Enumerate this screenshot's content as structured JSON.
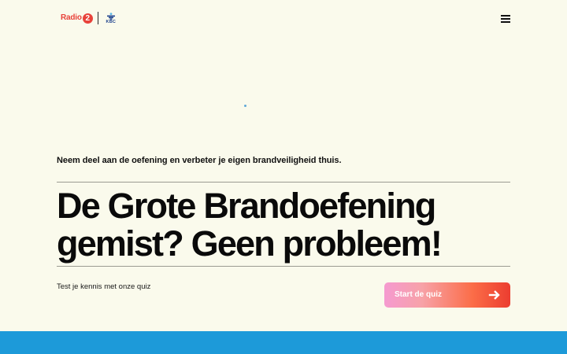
{
  "header": {
    "logo": {
      "radio_text": "Radio",
      "radio_number": "2",
      "partner_text": "KBC"
    },
    "menu_icon": "hamburger-menu-icon"
  },
  "hero": {
    "subtitle": "Neem deel aan de oefening en verbeter je eigen brandveiligheid thuis.",
    "headline_line1": "De Grote Brandoefening",
    "headline_line2": "gemist? Geen probleem!",
    "quiz_prompt": "Test je kennis met onze quiz",
    "quiz_button_label": "Start de quiz",
    "quiz_button_icon": "arrow-right-icon"
  },
  "colors": {
    "background": "#fafaec",
    "radio_red": "#e8423a",
    "kbc_blue": "#1a3f8c",
    "footer_blue": "#1d9ad9",
    "button_gradient_start": "#f59ad0",
    "button_gradient_end": "#ec3d30"
  }
}
